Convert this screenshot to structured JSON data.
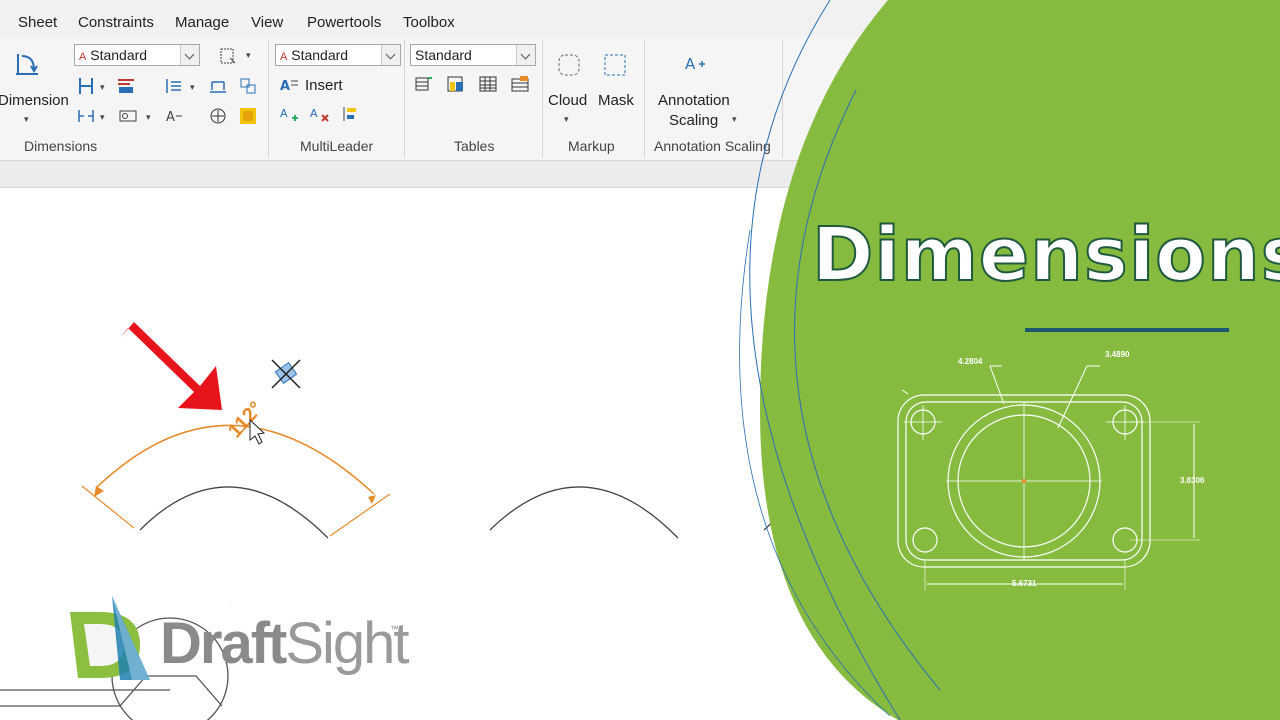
{
  "menu": [
    "Sheet",
    "Constraints",
    "Manage",
    "View",
    "Powertools",
    "Toolbox"
  ],
  "ribbon": {
    "dimensions": {
      "label": "Dimensions",
      "dimension_button": "Dimension",
      "style_dropdown": "Standard"
    },
    "multileader": {
      "label": "MultiLeader",
      "style_dropdown": "Standard",
      "insert_label": "Insert"
    },
    "tables": {
      "label": "Tables",
      "style_dropdown": "Standard"
    },
    "markup": {
      "label": "Markup",
      "cloud_label": "Cloud",
      "mask_label": "Mask"
    },
    "annotation_scaling": {
      "label": "Annotation Scaling",
      "button_line1": "Annotation",
      "button_line2": "Scaling"
    }
  },
  "drawing": {
    "angle_dimension": "112°",
    "accent_color": "#e8892a",
    "arrow_color": "#e8141b"
  },
  "panel": {
    "title": "Dimensions",
    "background": "#86bb3f",
    "rule_color": "#1d5873",
    "part_dims": {
      "top_left": "4.2804",
      "top_right": "3.4890",
      "right": "3.8306",
      "bottom": "5.6731"
    }
  },
  "logo": {
    "word_bold": "Draft",
    "word_light": "Sight",
    "tm": "™"
  }
}
